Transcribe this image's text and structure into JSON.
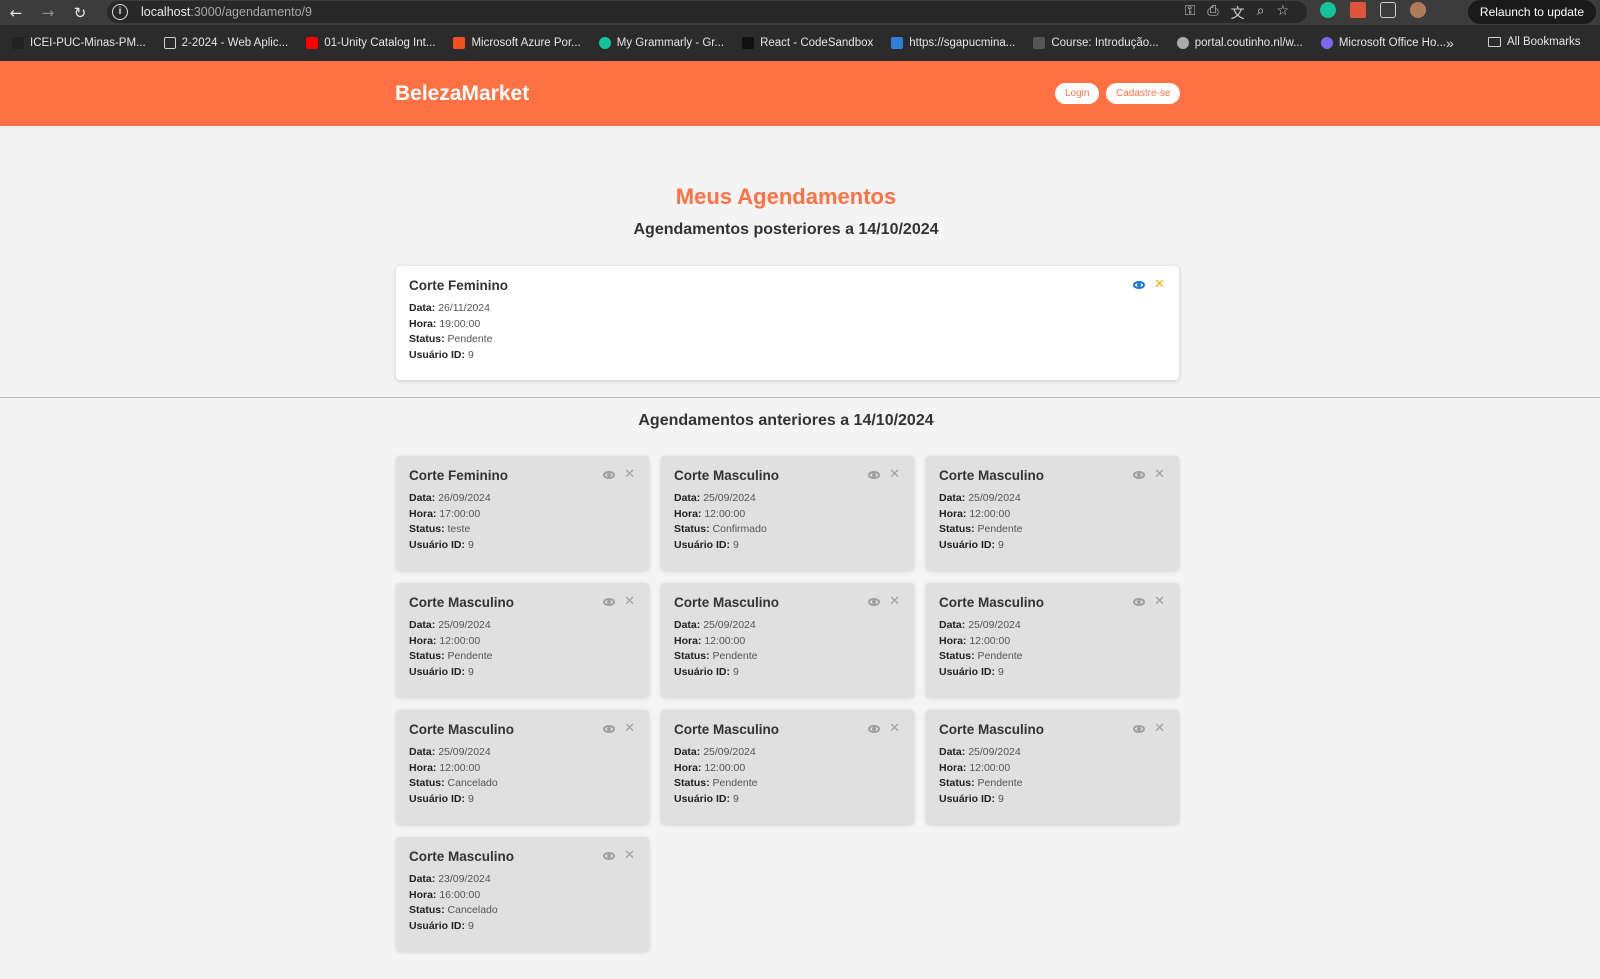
{
  "browser": {
    "url_host": "localhost",
    "url_path": ":3000/agendamento/9",
    "relaunch_label": "Relaunch to update",
    "bookmarks": [
      {
        "label": "ICEI-PUC-Minas-PM...",
        "icon": "github-icon",
        "color": "#222222"
      },
      {
        "label": "2-2024 - Web Aplic...",
        "icon": "folder-icon",
        "color": "#cfcfcf"
      },
      {
        "label": "01-Unity Catalog Int...",
        "icon": "youtube-icon",
        "color": "#ff0000"
      },
      {
        "label": "Microsoft Azure Por...",
        "icon": "microsoft-icon",
        "color": "#f25022"
      },
      {
        "label": "My Grammarly - Gr...",
        "icon": "grammarly-icon",
        "color": "#15c39a"
      },
      {
        "label": "React - CodeSandbox",
        "icon": "codesandbox-icon",
        "color": "#111111"
      },
      {
        "label": "https://sgapucmina...",
        "icon": "cloud-icon",
        "color": "#2f7fd8"
      },
      {
        "label": "Course: Introdução...",
        "icon": "course-icon",
        "color": "#555555"
      },
      {
        "label": "portal.coutinho.nl/w...",
        "icon": "globe-icon",
        "color": "#aaaaaa"
      },
      {
        "label": "Microsoft Office Ho...",
        "icon": "office-icon",
        "color": "#7b68ee"
      }
    ],
    "all_bookmarks_label": "All Bookmarks"
  },
  "app": {
    "brand": "BelezaMarket",
    "login_label": "Login",
    "signup_label": "Cadastre-se",
    "accent_color": "#ff7043"
  },
  "page": {
    "title": "Meus Agendamentos",
    "upcoming_heading": "Agendamentos posteriores a 14/10/2024",
    "past_heading": "Agendamentos anteriores a 14/10/2024"
  },
  "labels": {
    "date": "Data:",
    "time": "Hora:",
    "status": "Status:",
    "user": "Usuário ID:"
  },
  "upcoming": [
    {
      "service": "Corte Feminino",
      "date": "26/11/2024",
      "time": "19:00:00",
      "status": "Pendente",
      "user_id": "9"
    }
  ],
  "past": [
    {
      "service": "Corte Feminino",
      "date": "26/09/2024",
      "time": "17:00:00",
      "status": "teste",
      "user_id": "9"
    },
    {
      "service": "Corte Masculino",
      "date": "25/09/2024",
      "time": "12:00:00",
      "status": "Confirmado",
      "user_id": "9"
    },
    {
      "service": "Corte Masculino",
      "date": "25/09/2024",
      "time": "12:00:00",
      "status": "Pendente",
      "user_id": "9"
    },
    {
      "service": "Corte Masculino",
      "date": "25/09/2024",
      "time": "12:00:00",
      "status": "Pendente",
      "user_id": "9"
    },
    {
      "service": "Corte Masculino",
      "date": "25/09/2024",
      "time": "12:00:00",
      "status": "Pendente",
      "user_id": "9"
    },
    {
      "service": "Corte Masculino",
      "date": "25/09/2024",
      "time": "12:00:00",
      "status": "Pendente",
      "user_id": "9"
    },
    {
      "service": "Corte Masculino",
      "date": "25/09/2024",
      "time": "12:00:00",
      "status": "Cancelado",
      "user_id": "9"
    },
    {
      "service": "Corte Masculino",
      "date": "25/09/2024",
      "time": "12:00:00",
      "status": "Pendente",
      "user_id": "9"
    },
    {
      "service": "Corte Masculino",
      "date": "25/09/2024",
      "time": "12:00:00",
      "status": "Pendente",
      "user_id": "9"
    },
    {
      "service": "Corte Masculino",
      "date": "23/09/2024",
      "time": "16:00:00",
      "status": "Cancelado",
      "user_id": "9"
    }
  ]
}
